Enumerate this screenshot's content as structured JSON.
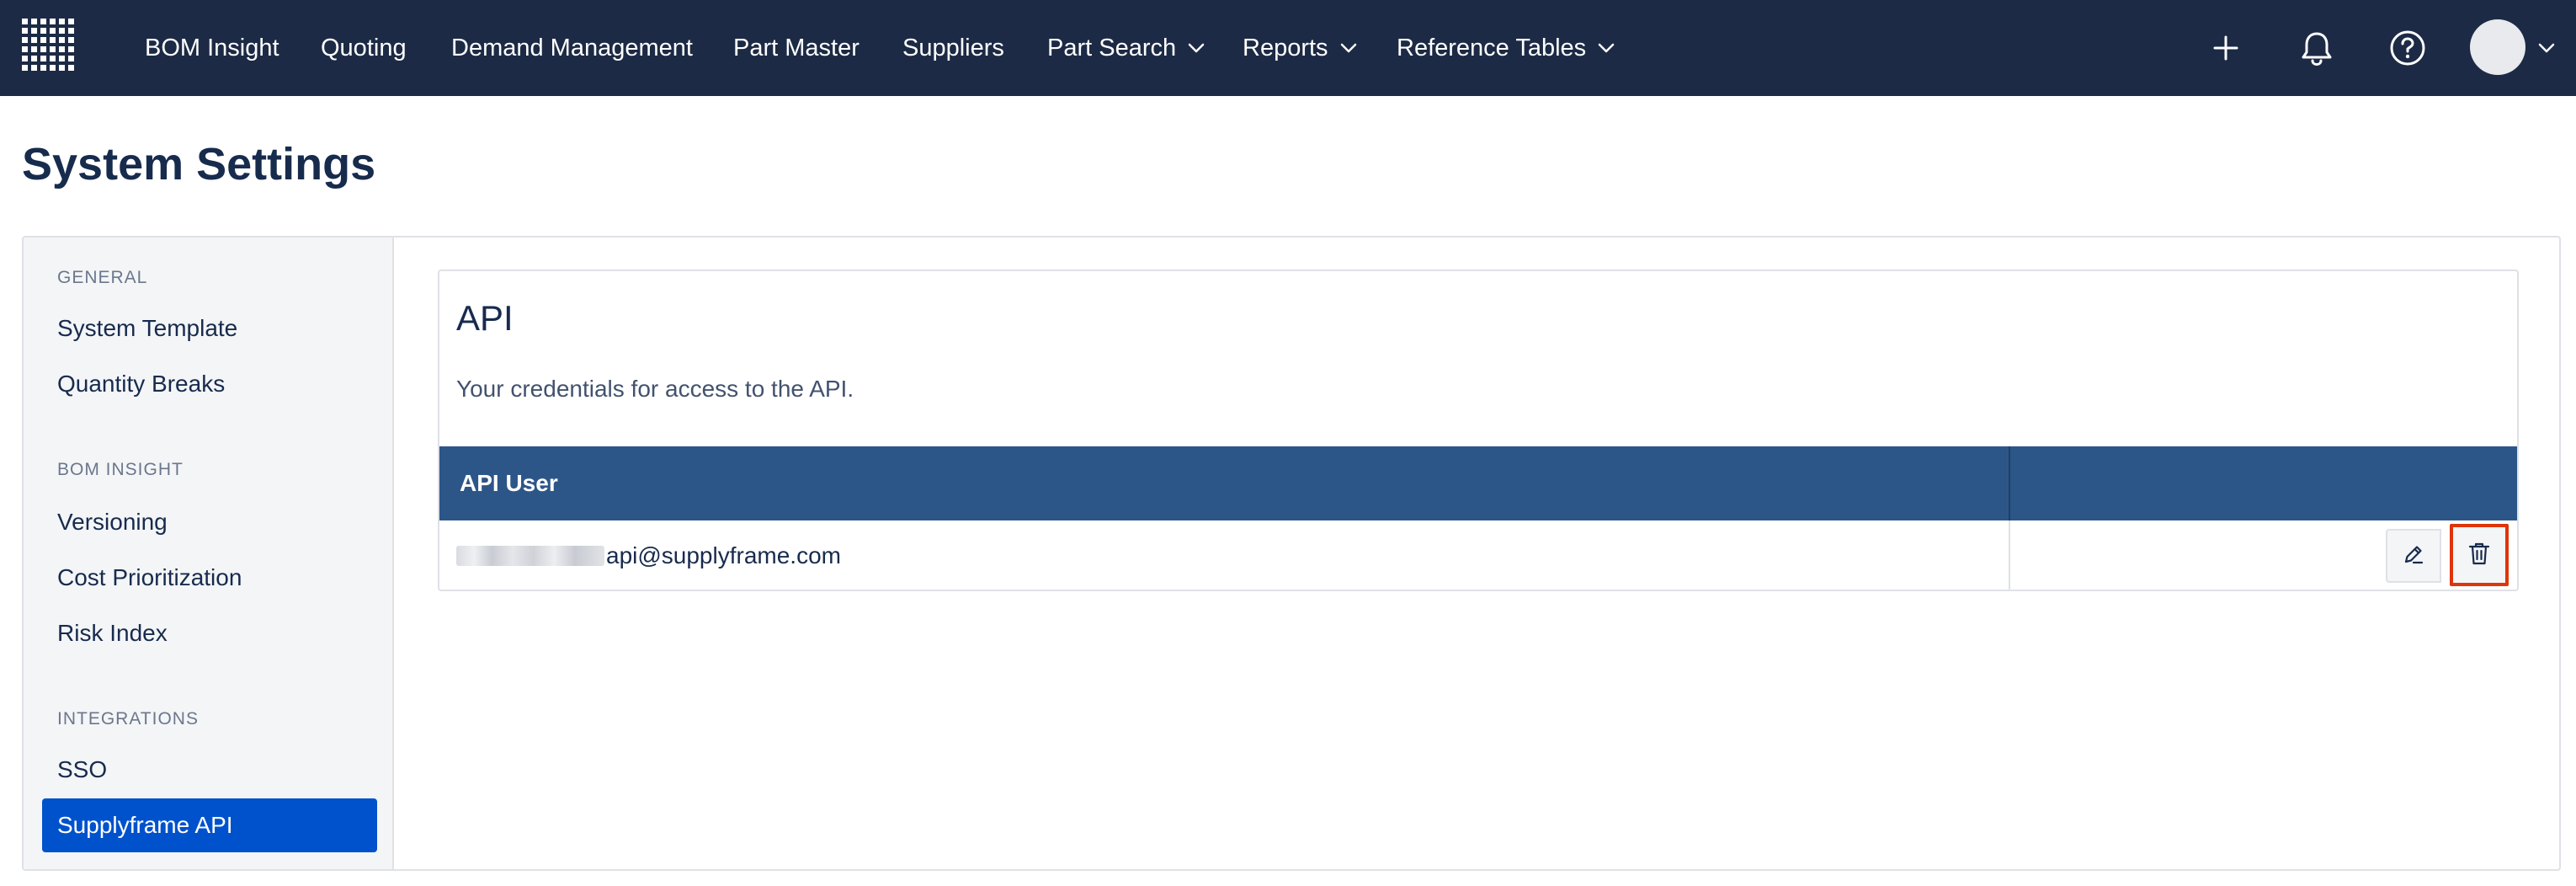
{
  "nav": {
    "items": [
      {
        "label": "BOM Insight",
        "dropdown": false
      },
      {
        "label": "Quoting",
        "dropdown": false
      },
      {
        "label": "Demand Management",
        "dropdown": false
      },
      {
        "label": "Part Master",
        "dropdown": false
      },
      {
        "label": "Suppliers",
        "dropdown": false
      },
      {
        "label": "Part Search",
        "dropdown": true
      },
      {
        "label": "Reports",
        "dropdown": true
      },
      {
        "label": "Reference Tables",
        "dropdown": true
      }
    ],
    "icons": [
      "plus-icon",
      "bell-icon",
      "help-icon",
      "avatar",
      "chevron-down-icon"
    ],
    "background_color": "#1c2a45"
  },
  "page": {
    "title": "System Settings"
  },
  "sidebar": {
    "sections": [
      {
        "heading": "GENERAL",
        "items": [
          "System Template",
          "Quantity Breaks"
        ]
      },
      {
        "heading": "BOM INSIGHT",
        "items": [
          "Versioning",
          "Cost Prioritization",
          "Risk Index"
        ]
      },
      {
        "heading": "INTEGRATIONS",
        "items": [
          "SSO",
          "Supplyframe API"
        ]
      }
    ],
    "active_item": "Supplyframe API",
    "active_color": "#0052cc"
  },
  "api_card": {
    "title": "API",
    "description": "Your credentials for access to the API.",
    "table": {
      "columns": [
        "API User",
        ""
      ],
      "header_color": "#2d5688",
      "rows": [
        {
          "email_visible_suffix": "api@supplyframe.com",
          "email_prefix_redacted": true,
          "actions": [
            "edit-icon",
            "trash-icon"
          ]
        }
      ]
    },
    "highlight_color": "#de350b"
  }
}
